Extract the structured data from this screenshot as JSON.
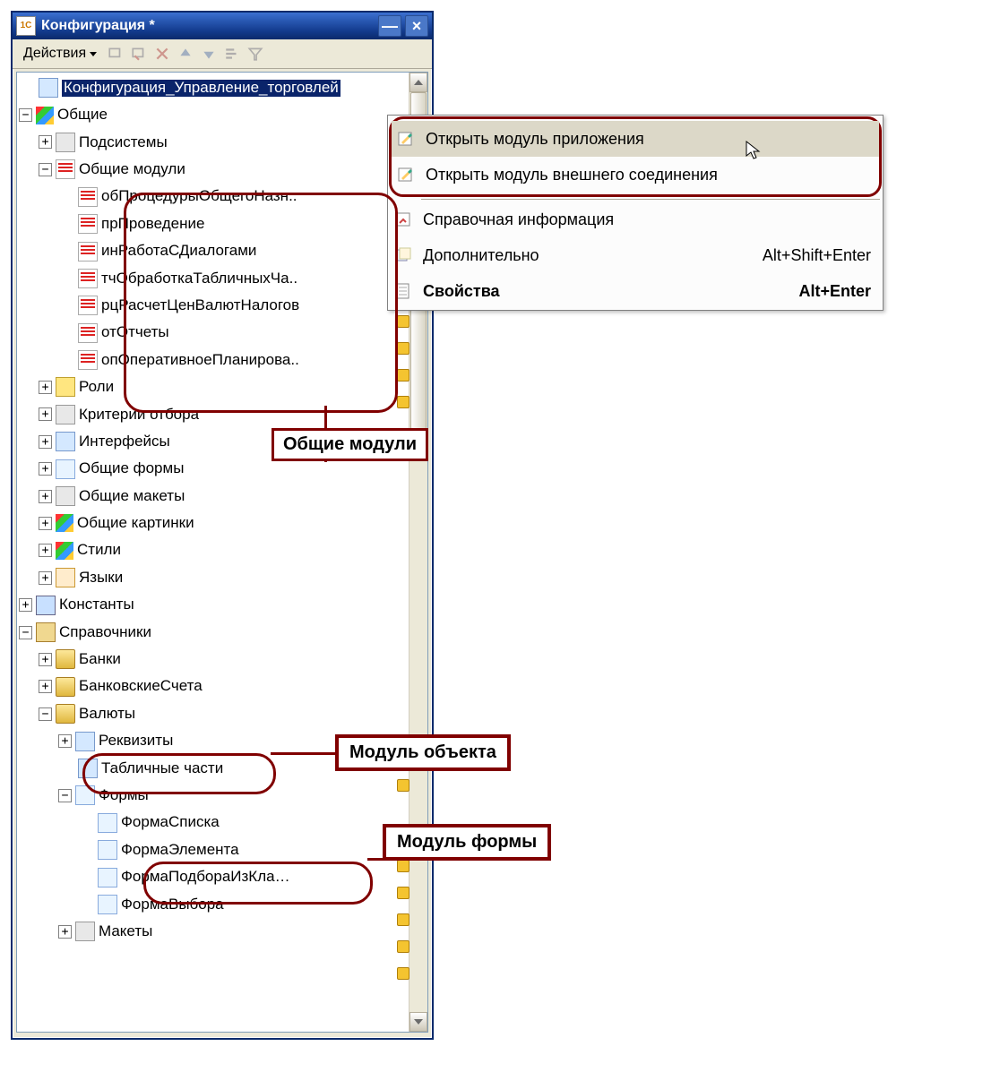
{
  "window": {
    "title": "Конфигурация *"
  },
  "toolbar": {
    "actions_label": "Действия"
  },
  "tree": {
    "root": "Конфигурация_Управление_торговлей",
    "common": "Общие",
    "subsystems": "Подсистемы",
    "common_modules": "Общие модули",
    "modules": [
      "обПроцедурыОбщегоНазн..",
      "прПроведение",
      "инРаботаСДиалогами",
      "тчОбработкаТабличныхЧа..",
      "рцРасчетЦенВалютНалогов",
      "отОтчеты",
      "опОперативноеПланирова.."
    ],
    "roles": "Роли",
    "criteria": "Критерии отбора",
    "interfaces": "Интерфейсы",
    "common_forms": "Общие формы",
    "common_templates": "Общие макеты",
    "common_pictures": "Общие картинки",
    "styles": "Стили",
    "languages": "Языки",
    "constants": "Константы",
    "catalogs": "Справочники",
    "banks": "Банки",
    "bank_accounts": "БанковскиеСчета",
    "currencies": "Валюты",
    "requisites": "Реквизиты",
    "tab_parts": "Табличные части",
    "forms": "Формы",
    "form_list": "ФормаСписка",
    "form_element": "ФормаЭлемента",
    "form_pick": "ФормаПодбораИзКла…",
    "form_choice": "ФормаВыбора",
    "templates": "Макеты"
  },
  "context_menu": {
    "open_app_module": "Открыть модуль приложения",
    "open_ext_module": "Открыть модуль внешнего соединения",
    "help": "Справочная информация",
    "additional": "Дополнительно",
    "additional_sc": "Alt+Shift+Enter",
    "properties": "Свойства",
    "properties_sc": "Alt+Enter"
  },
  "callouts": {
    "modules": "Общие модули",
    "object_module": "Модуль объекта",
    "form_module": "Модуль формы"
  }
}
